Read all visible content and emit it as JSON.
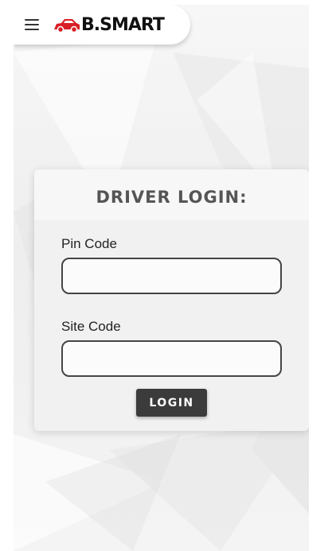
{
  "header": {
    "brand_name": "B.SMART",
    "menu_icon": "hamburger-menu-icon",
    "logo_icon": "red-car-logo-icon",
    "brand_color": "#d81f26"
  },
  "login": {
    "title": "DRIVER LOGIN:",
    "pin_label": "Pin Code",
    "pin_value": "",
    "site_label": "Site Code",
    "site_value": "",
    "button_label": "LOGIN",
    "button_color": "#3b3b3b"
  }
}
